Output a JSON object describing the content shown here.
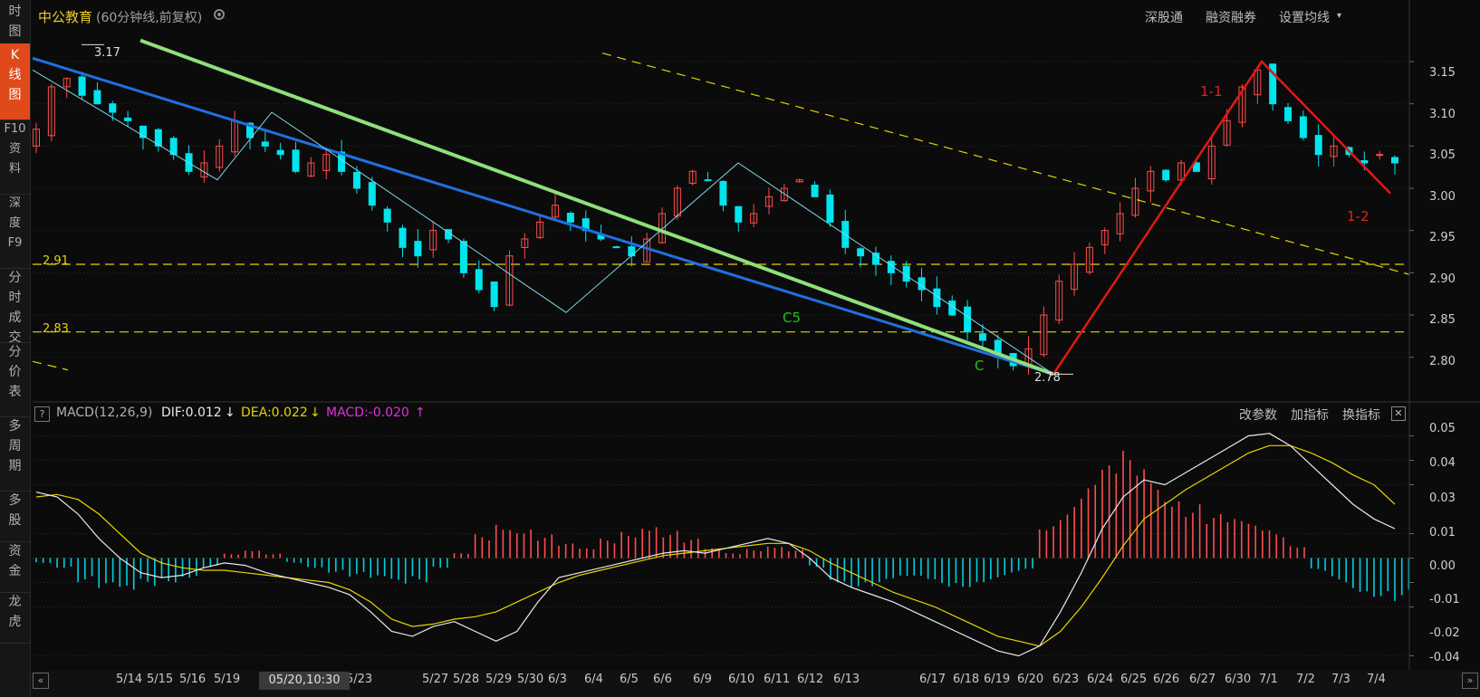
{
  "sidebar": {
    "items": [
      {
        "label": "时图",
        "active": false
      },
      {
        "label": "K线图",
        "active": true
      },
      {
        "label": "F10资料",
        "active": false
      },
      {
        "label": "深度F9",
        "active": false
      },
      {
        "label": "分时成交",
        "active": false
      },
      {
        "label": "分价表",
        "active": false
      },
      {
        "label": "多周期",
        "active": false
      },
      {
        "label": "多股",
        "active": false
      },
      {
        "label": "资金",
        "active": false
      },
      {
        "label": "龙虎",
        "active": false
      }
    ]
  },
  "header": {
    "stock_name": "中公教育",
    "chart_mode": "(60分钟线,前复权)",
    "links": [
      "深股通",
      "融资融券",
      "设置均线"
    ]
  },
  "price_panel": {
    "annotations": {
      "high": "3.17",
      "low": "2.78",
      "level_291": "2.91",
      "level_283": "2.83",
      "c5": "C5",
      "c": "C",
      "wave_1_1": "1-1",
      "wave_1_2": "1-2"
    },
    "axis_ticks": [
      "3.15",
      "3.10",
      "3.05",
      "3.00",
      "2.95",
      "2.90",
      "2.85",
      "2.80"
    ]
  },
  "macd_header": {
    "help": "?",
    "name": "MACD(12,26,9)",
    "dif": "DIF:0.012",
    "dea": "DEA:0.022",
    "macd": "MACD:-0.020",
    "actions": [
      "改参数",
      "加指标",
      "换指标"
    ]
  },
  "macd_axis_ticks": [
    "0.05",
    "0.04",
    "0.03",
    "0.01",
    "0.00",
    "-0.01",
    "-0.02",
    "-0.04"
  ],
  "time_axis": [
    "5/14",
    "5/15",
    "5/16",
    "5/19",
    "5/23",
    "5/27",
    "5/28",
    "5/29",
    "5/30",
    "6/3",
    "6/4",
    "6/5",
    "6/6",
    "6/9",
    "6/10",
    "6/11",
    "6/12",
    "6/13",
    "6/17",
    "6/18",
    "6/19",
    "6/20",
    "6/23",
    "6/24",
    "6/25",
    "6/26",
    "6/27",
    "6/30",
    "7/1",
    "7/2",
    "7/3",
    "7/4"
  ],
  "time_badge": "05/20,10:30",
  "colors": {
    "up": "#ff4d4d",
    "down": "#00e5ee",
    "dif": "#e8e8e8",
    "dea": "#e8d400",
    "macd_pos": "#ff4d4d",
    "macd_neg": "#00d0e0",
    "accent": "#e04a1a"
  },
  "chart_data": [
    {
      "type": "candlestick",
      "title": "中公教育 (60分钟线,前复权)",
      "ylim": [
        2.76,
        3.18
      ],
      "y_ticks": [
        2.8,
        2.85,
        2.9,
        2.95,
        3.0,
        3.05,
        3.1,
        3.15
      ],
      "horizontal_levels": [
        2.91,
        2.83
      ],
      "marked_high": 3.17,
      "marked_low": 2.78,
      "close_path": [
        3.07,
        3.12,
        3.13,
        3.11,
        3.1,
        3.09,
        3.08,
        3.06,
        3.05,
        3.04,
        3.02,
        3.03,
        3.05,
        3.08,
        3.06,
        3.05,
        3.04,
        3.02,
        3.03,
        3.04,
        3.02,
        3.0,
        2.98,
        2.96,
        2.93,
        2.92,
        2.95,
        2.94,
        2.9,
        2.88,
        2.86,
        2.92,
        2.94,
        2.96,
        2.98,
        2.96,
        2.95,
        2.94,
        2.93,
        2.92,
        2.94,
        2.97,
        3.0,
        3.02,
        3.01,
        2.98,
        2.96,
        2.97,
        2.99,
        3.0,
        3.01,
        2.99,
        2.96,
        2.93,
        2.92,
        2.91,
        2.9,
        2.89,
        2.88,
        2.86,
        2.85,
        2.83,
        2.82,
        2.8,
        2.79,
        2.81,
        2.85,
        2.89,
        2.91,
        2.93,
        2.95,
        2.97,
        3.0,
        3.02,
        3.01,
        3.03,
        3.02,
        3.05,
        3.08,
        3.12,
        3.14,
        3.1,
        3.08,
        3.06,
        3.04,
        3.05,
        3.04,
        3.03,
        3.04,
        3.03
      ]
    },
    {
      "type": "macd",
      "ylim": [
        -0.045,
        0.055
      ],
      "y_ticks": [
        0.05,
        0.04,
        0.03,
        0.01,
        0.0,
        -0.01,
        -0.02,
        -0.04
      ],
      "dif": [
        0.027,
        0.025,
        0.018,
        0.008,
        0.0,
        -0.006,
        -0.008,
        -0.007,
        -0.004,
        -0.002,
        -0.003,
        -0.006,
        -0.008,
        -0.01,
        -0.012,
        -0.015,
        -0.022,
        -0.03,
        -0.032,
        -0.028,
        -0.026,
        -0.03,
        -0.034,
        -0.03,
        -0.018,
        -0.008,
        -0.006,
        -0.004,
        -0.002,
        0.0,
        0.002,
        0.003,
        0.002,
        0.004,
        0.006,
        0.008,
        0.006,
        0.0,
        -0.008,
        -0.012,
        -0.015,
        -0.018,
        -0.022,
        -0.026,
        -0.03,
        -0.034,
        -0.038,
        -0.04,
        -0.036,
        -0.022,
        -0.006,
        0.012,
        0.025,
        0.032,
        0.03,
        0.035,
        0.04,
        0.045,
        0.05,
        0.051,
        0.046,
        0.038,
        0.03,
        0.022,
        0.016,
        0.012
      ],
      "dea": [
        0.025,
        0.026,
        0.024,
        0.018,
        0.01,
        0.002,
        -0.002,
        -0.004,
        -0.005,
        -0.005,
        -0.006,
        -0.007,
        -0.008,
        -0.009,
        -0.01,
        -0.013,
        -0.018,
        -0.025,
        -0.028,
        -0.027,
        -0.025,
        -0.024,
        -0.022,
        -0.018,
        -0.014,
        -0.01,
        -0.007,
        -0.005,
        -0.003,
        -0.001,
        0.001,
        0.002,
        0.003,
        0.004,
        0.005,
        0.006,
        0.006,
        0.003,
        -0.002,
        -0.006,
        -0.01,
        -0.014,
        -0.017,
        -0.02,
        -0.024,
        -0.028,
        -0.032,
        -0.034,
        -0.036,
        -0.03,
        -0.02,
        -0.008,
        0.005,
        0.016,
        0.022,
        0.028,
        0.033,
        0.038,
        0.043,
        0.046,
        0.046,
        0.043,
        0.039,
        0.034,
        0.03,
        0.022
      ],
      "macd": [
        -0.002,
        -0.004,
        -0.01,
        -0.014,
        -0.016,
        -0.012,
        -0.01,
        -0.008,
        -0.004,
        0.002,
        0.004,
        0.002,
        -0.002,
        -0.004,
        -0.006,
        -0.008,
        -0.01,
        -0.012,
        -0.01,
        -0.004,
        0.002,
        0.01,
        0.016,
        0.014,
        0.01,
        0.006,
        0.004,
        0.008,
        0.012,
        0.016,
        0.012,
        0.008,
        0.004,
        0.002,
        0.004,
        0.006,
        0.004,
        -0.004,
        -0.01,
        -0.012,
        -0.012,
        -0.01,
        -0.01,
        -0.012,
        -0.012,
        -0.01,
        -0.008,
        -0.006,
        0.016,
        0.022,
        0.03,
        0.038,
        0.044,
        0.04,
        0.03,
        0.024,
        0.018,
        0.016,
        0.014,
        0.012,
        0.006,
        -0.006,
        -0.01,
        -0.014,
        -0.016,
        -0.018
      ]
    }
  ]
}
